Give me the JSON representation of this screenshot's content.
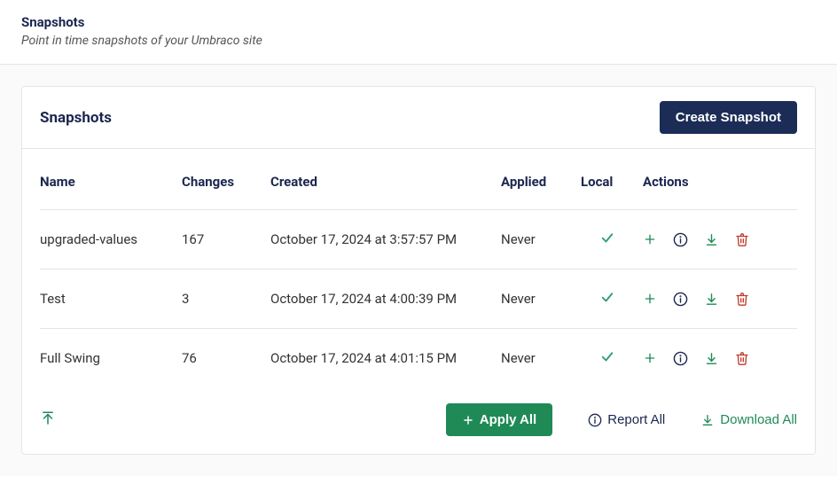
{
  "page": {
    "title": "Snapshots",
    "subtitle": "Point in time snapshots of your Umbraco site"
  },
  "card": {
    "title": "Snapshots",
    "create_label": "Create Snapshot"
  },
  "table": {
    "headers": {
      "name": "Name",
      "changes": "Changes",
      "created": "Created",
      "applied": "Applied",
      "local": "Local",
      "actions": "Actions"
    },
    "rows": [
      {
        "name": "upgraded-values",
        "changes": "167",
        "created": "October 17, 2024 at 3:57:57 PM",
        "applied": "Never",
        "local": true
      },
      {
        "name": "Test",
        "changes": "3",
        "created": "October 17, 2024 at 4:00:39 PM",
        "applied": "Never",
        "local": true
      },
      {
        "name": "Full Swing",
        "changes": "76",
        "created": "October 17, 2024 at 4:01:15 PM",
        "applied": "Never",
        "local": true
      }
    ]
  },
  "footer": {
    "apply_all": "Apply All",
    "report_all": "Report All",
    "download_all": "Download All"
  },
  "icons": {
    "plus": "plus-icon",
    "info": "info-icon",
    "download": "download-icon",
    "trash": "trash-icon",
    "check": "check-icon",
    "upload": "upload-icon"
  },
  "colors": {
    "primary_dark": "#1b2c57",
    "green": "#1f8a56",
    "red": "#c0392b"
  }
}
